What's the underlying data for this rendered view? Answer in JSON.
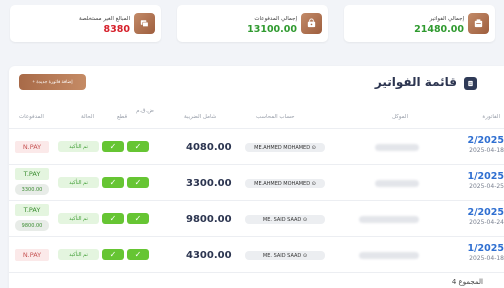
{
  "cards": [
    {
      "label": "إجمالي الفواتير",
      "value": "21480.00",
      "color": "#2f9a2f",
      "icon": "invoice-icon"
    },
    {
      "label": "إجمالي المدفوعات",
      "value": "13100.00",
      "color": "#2f9a2f",
      "icon": "wallet-icon"
    },
    {
      "label": "المبالغ الغير مستخلصة",
      "value": "8380",
      "color": "#d6202b",
      "icon": "money-icon"
    }
  ],
  "panel": {
    "title": "قائمة الفواتير",
    "add_button": "+ إضافة فاتورة جديدة",
    "total_label": "4 المجموع"
  },
  "columns": {
    "invoice": "الفاتورة",
    "client": "الموكل",
    "accountant": "حساب المحاسب",
    "amount": "شامل الضريبة",
    "pm": "ض.ق.م",
    "cut": "قطع",
    "status": "الحالة",
    "payments": "المدفوعات"
  },
  "rows": [
    {
      "invoice": "2/2025",
      "date": "2025-04-18",
      "accountant": "ME.AHMED MOHAMED ⊙",
      "amount": "4080.00",
      "check1": "✓",
      "check2": "✓",
      "status": "تم التأكيد",
      "payment": "N.PAY",
      "payment_type": "np",
      "payment_sub": ""
    },
    {
      "invoice": "1/2025",
      "date": "2025-04-25",
      "accountant": "ME.AHMED MOHAMED ⊙",
      "amount": "3300.00",
      "check1": "✓",
      "check2": "✓",
      "status": "تم التأكيد",
      "payment": "T.PAY",
      "payment_type": "tp",
      "payment_sub": "3300.00"
    },
    {
      "invoice": "2/2025",
      "date": "2025-04-24",
      "accountant": "ME. SAID SAAD ⊙",
      "amount": "9800.00",
      "check1": "✓",
      "check2": "✓",
      "status": "تم التأكيد",
      "payment": "T.PAY",
      "payment_type": "tp",
      "payment_sub": "9800.00"
    },
    {
      "invoice": "1/2025",
      "date": "2025-04-18",
      "accountant": "ME. SAID SAAD ⊙",
      "amount": "4300.00",
      "check1": "✓",
      "check2": "✓",
      "status": "تم التأكيد",
      "payment": "N.PAY",
      "payment_type": "np",
      "payment_sub": ""
    }
  ]
}
